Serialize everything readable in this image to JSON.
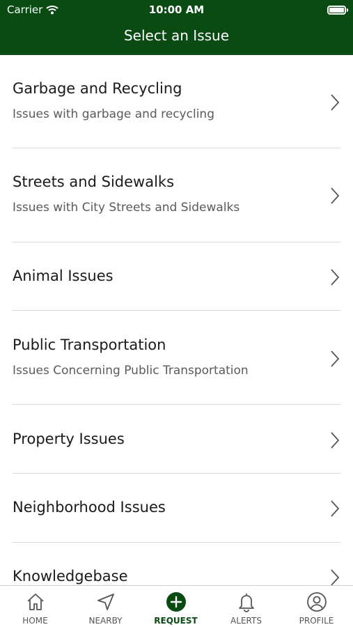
{
  "status_bar": {
    "carrier": "Carrier",
    "time": "10:00 AM"
  },
  "nav": {
    "title": "Select an Issue"
  },
  "issues": [
    {
      "title": "Garbage and Recycling",
      "subtitle": "Issues with garbage and recycling"
    },
    {
      "title": "Streets and Sidewalks",
      "subtitle": "Issues with City Streets and Sidewalks"
    },
    {
      "title": "Animal Issues",
      "subtitle": ""
    },
    {
      "title": "Public Transportation",
      "subtitle": "Issues Concerning Public Transportation"
    },
    {
      "title": "Property Issues",
      "subtitle": ""
    },
    {
      "title": "Neighborhood Issues",
      "subtitle": ""
    },
    {
      "title": "Knowledgebase",
      "subtitle": ""
    }
  ],
  "tabs": [
    {
      "label": "HOME",
      "icon": "home-icon"
    },
    {
      "label": "NEARBY",
      "icon": "location-arrow-icon"
    },
    {
      "label": "REQUEST",
      "icon": "plus-circle-icon",
      "active": true
    },
    {
      "label": "ALERTS",
      "icon": "bell-icon"
    },
    {
      "label": "PROFILE",
      "icon": "user-circle-icon"
    }
  ],
  "colors": {
    "brand": "#0a4a13",
    "text": "#1a1a1a",
    "subtext": "#5a5a5a",
    "divider": "#d9d9d9"
  }
}
